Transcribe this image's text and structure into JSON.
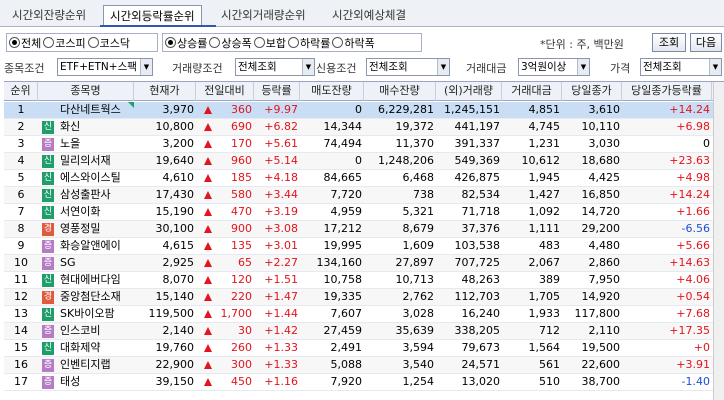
{
  "tabs": [
    "시간외잔량순위",
    "시간외등락률순위",
    "시간외거래량순위",
    "시간외예상체결"
  ],
  "market_options": [
    {
      "label": "전체",
      "on": true
    },
    {
      "label": "코스피",
      "on": false
    },
    {
      "label": "코스닥",
      "on": false
    }
  ],
  "direction_options": [
    {
      "label": "상승률",
      "on": true
    },
    {
      "label": "상승폭",
      "on": false
    },
    {
      "label": "보합",
      "on": false
    },
    {
      "label": "하락률",
      "on": false
    },
    {
      "label": "하락폭",
      "on": false
    }
  ],
  "unit_text": "*단위 : 주, 백만원",
  "buttons": {
    "query": "조회",
    "next": "다음"
  },
  "filters": {
    "stock_condition_label": "종목조건",
    "stock_condition_value": "ETF+ETN+스팩 제!",
    "volume_condition_label": "거래량조건",
    "volume_condition_value": "전체조회",
    "credit_condition_label": "신용조건",
    "credit_condition_value": "전체조회",
    "amount_label": "거래대금",
    "amount_value": "3억원이상",
    "price_label": "가격",
    "price_value": "전체조회"
  },
  "table": {
    "headers": [
      "순위",
      "종목명",
      "현재가",
      "전일대비",
      "등락률",
      "매도잔량",
      "매수잔량",
      "(외)거래량",
      "거래대금",
      "당일종가",
      "당일종가등락률"
    ],
    "rows": [
      {
        "rank": "1",
        "badge": "",
        "name": "다산네트웍스",
        "price": "3,970",
        "change": "360",
        "rate": "+9.97",
        "sell": "0",
        "buy": "6,229,281",
        "volume": "1,245,151",
        "amount": "4,851",
        "close": "3,610",
        "close_rate": "+14.24",
        "close_dir": "up",
        "selected": true
      },
      {
        "rank": "2",
        "badge": "신",
        "name": "화신",
        "price": "10,800",
        "change": "690",
        "rate": "+6.82",
        "sell": "14,344",
        "buy": "19,372",
        "volume": "441,197",
        "amount": "4,745",
        "close": "10,110",
        "close_rate": "+6.98",
        "close_dir": "up"
      },
      {
        "rank": "3",
        "badge": "증",
        "name": "노을",
        "price": "3,200",
        "change": "170",
        "rate": "+5.61",
        "sell": "74,494",
        "buy": "11,370",
        "volume": "391,337",
        "amount": "1,231",
        "close": "3,030",
        "close_rate": "0",
        "close_dir": "flat"
      },
      {
        "rank": "4",
        "badge": "신",
        "name": "밀리의서재",
        "price": "19,640",
        "change": "960",
        "rate": "+5.14",
        "sell": "0",
        "buy": "1,248,206",
        "volume": "549,369",
        "amount": "10,612",
        "close": "18,680",
        "close_rate": "+23.63",
        "close_dir": "up"
      },
      {
        "rank": "5",
        "badge": "신",
        "name": "에스와이스틸",
        "price": "4,610",
        "change": "185",
        "rate": "+4.18",
        "sell": "84,665",
        "buy": "6,468",
        "volume": "426,875",
        "amount": "1,945",
        "close": "4,425",
        "close_rate": "+4.98",
        "close_dir": "up"
      },
      {
        "rank": "6",
        "badge": "신",
        "name": "삼성출판사",
        "price": "17,430",
        "change": "580",
        "rate": "+3.44",
        "sell": "7,720",
        "buy": "738",
        "volume": "82,534",
        "amount": "1,427",
        "close": "16,850",
        "close_rate": "+14.24",
        "close_dir": "up"
      },
      {
        "rank": "7",
        "badge": "신",
        "name": "서연이화",
        "price": "15,190",
        "change": "470",
        "rate": "+3.19",
        "sell": "4,959",
        "buy": "5,321",
        "volume": "71,718",
        "amount": "1,092",
        "close": "14,720",
        "close_rate": "+1.66",
        "close_dir": "up"
      },
      {
        "rank": "8",
        "badge": "경",
        "name": "영풍정밀",
        "price": "30,100",
        "change": "900",
        "rate": "+3.08",
        "sell": "17,212",
        "buy": "8,679",
        "volume": "37,376",
        "amount": "1,111",
        "close": "29,200",
        "close_rate": "-6.56",
        "close_dir": "down"
      },
      {
        "rank": "9",
        "badge": "증",
        "name": "화승알앤에이",
        "price": "4,615",
        "change": "135",
        "rate": "+3.01",
        "sell": "19,995",
        "buy": "1,609",
        "volume": "103,538",
        "amount": "483",
        "close": "4,480",
        "close_rate": "+5.66",
        "close_dir": "up"
      },
      {
        "rank": "10",
        "badge": "증",
        "name": "SG",
        "price": "2,925",
        "change": "65",
        "rate": "+2.27",
        "sell": "134,160",
        "buy": "27,897",
        "volume": "707,725",
        "amount": "2,067",
        "close": "2,860",
        "close_rate": "+14.63",
        "close_dir": "up"
      },
      {
        "rank": "11",
        "badge": "신",
        "name": "현대에버다임",
        "price": "8,070",
        "change": "120",
        "rate": "+1.51",
        "sell": "10,758",
        "buy": "10,713",
        "volume": "48,263",
        "amount": "389",
        "close": "7,950",
        "close_rate": "+4.06",
        "close_dir": "up"
      },
      {
        "rank": "12",
        "badge": "경",
        "name": "중앙첨단소재",
        "price": "15,140",
        "change": "220",
        "rate": "+1.47",
        "sell": "19,335",
        "buy": "2,762",
        "volume": "112,703",
        "amount": "1,705",
        "close": "14,920",
        "close_rate": "+0.54",
        "close_dir": "up"
      },
      {
        "rank": "13",
        "badge": "신",
        "name": "SK바이오팜",
        "price": "119,500",
        "change": "1,700",
        "rate": "+1.44",
        "sell": "7,607",
        "buy": "3,028",
        "volume": "16,240",
        "amount": "1,933",
        "close": "117,800",
        "close_rate": "+7.68",
        "close_dir": "up"
      },
      {
        "rank": "14",
        "badge": "증",
        "name": "인스코비",
        "price": "2,140",
        "change": "30",
        "rate": "+1.42",
        "sell": "27,459",
        "buy": "35,639",
        "volume": "338,205",
        "amount": "712",
        "close": "2,110",
        "close_rate": "+17.35",
        "close_dir": "up"
      },
      {
        "rank": "15",
        "badge": "신",
        "name": "대화제약",
        "price": "19,760",
        "change": "260",
        "rate": "+1.33",
        "sell": "2,491",
        "buy": "3,594",
        "volume": "79,673",
        "amount": "1,564",
        "close": "19,500",
        "close_rate": "+0",
        "close_dir": "up"
      },
      {
        "rank": "16",
        "badge": "증",
        "name": "인벤티지랩",
        "price": "22,900",
        "change": "300",
        "rate": "+1.33",
        "sell": "5,088",
        "buy": "3,540",
        "volume": "24,571",
        "amount": "561",
        "close": "22,600",
        "close_rate": "+3.91",
        "close_dir": "up"
      },
      {
        "rank": "17",
        "badge": "증",
        "name": "태성",
        "price": "39,150",
        "change": "450",
        "rate": "+1.16",
        "sell": "7,920",
        "buy": "1,254",
        "volume": "13,020",
        "amount": "510",
        "close": "38,700",
        "close_rate": "-1.40",
        "close_dir": "down"
      }
    ]
  }
}
